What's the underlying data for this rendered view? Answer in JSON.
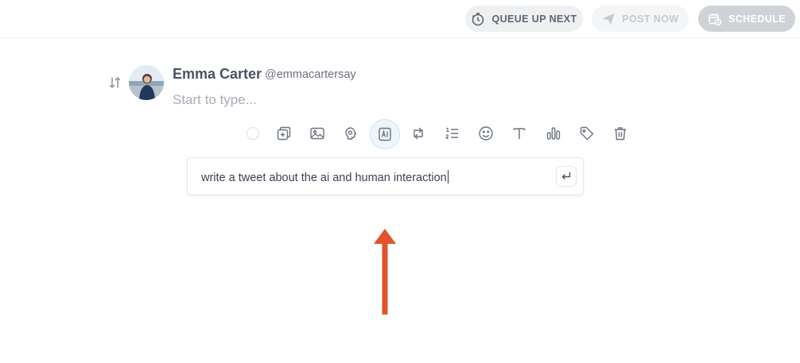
{
  "toolbar": {
    "queue_label": "QUEUE UP NEXT",
    "post_label": "POST NOW",
    "schedule_label": "SCHEDULE"
  },
  "composer": {
    "author_name": "Emma Carter",
    "author_handle": "@emmacartersay",
    "placeholder": "Start to type..."
  },
  "tools": [
    "circle-indicator",
    "add-tweet-icon",
    "image-icon",
    "brain-icon",
    "ai-icon",
    "retweet-icon",
    "numbered-list-icon",
    "emoji-icon",
    "text-format-icon",
    "poll-icon",
    "tag-icon",
    "trash-icon"
  ],
  "ai_prompt": {
    "value": "write a tweet about the ai and human interaction"
  },
  "colors": {
    "arrow": "#e2532b",
    "active_tool_bg": "#eef6fb"
  }
}
